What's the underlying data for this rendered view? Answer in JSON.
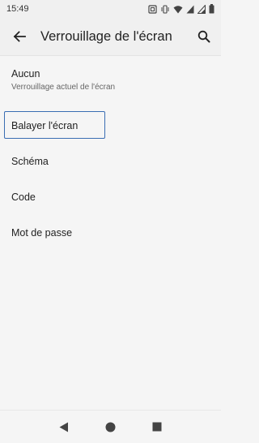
{
  "status_bar": {
    "time": "15:49",
    "icons": [
      "nfc-icon",
      "vibrate-icon",
      "wifi-icon",
      "signal-icon",
      "signal-icon",
      "battery-icon"
    ]
  },
  "app_bar": {
    "title": "Verrouillage de l'écran",
    "back_icon": "arrow-back-icon",
    "search_icon": "search-icon"
  },
  "options": {
    "aucun": {
      "label": "Aucun",
      "sub": "Verrouillage actuel de l'écran"
    },
    "balayer": {
      "label": "Balayer l'écran"
    },
    "schema": {
      "label": "Schéma"
    },
    "code": {
      "label": "Code"
    },
    "mot_de_passe": {
      "label": "Mot de passe"
    }
  },
  "nav_bar": {
    "icons": [
      "back-triangle-icon",
      "home-circle-icon",
      "recents-square-icon"
    ]
  },
  "colors": {
    "focus_border": "#3a6db3",
    "background": "#f5f5f5",
    "app_bar": "#f0f0f0"
  }
}
